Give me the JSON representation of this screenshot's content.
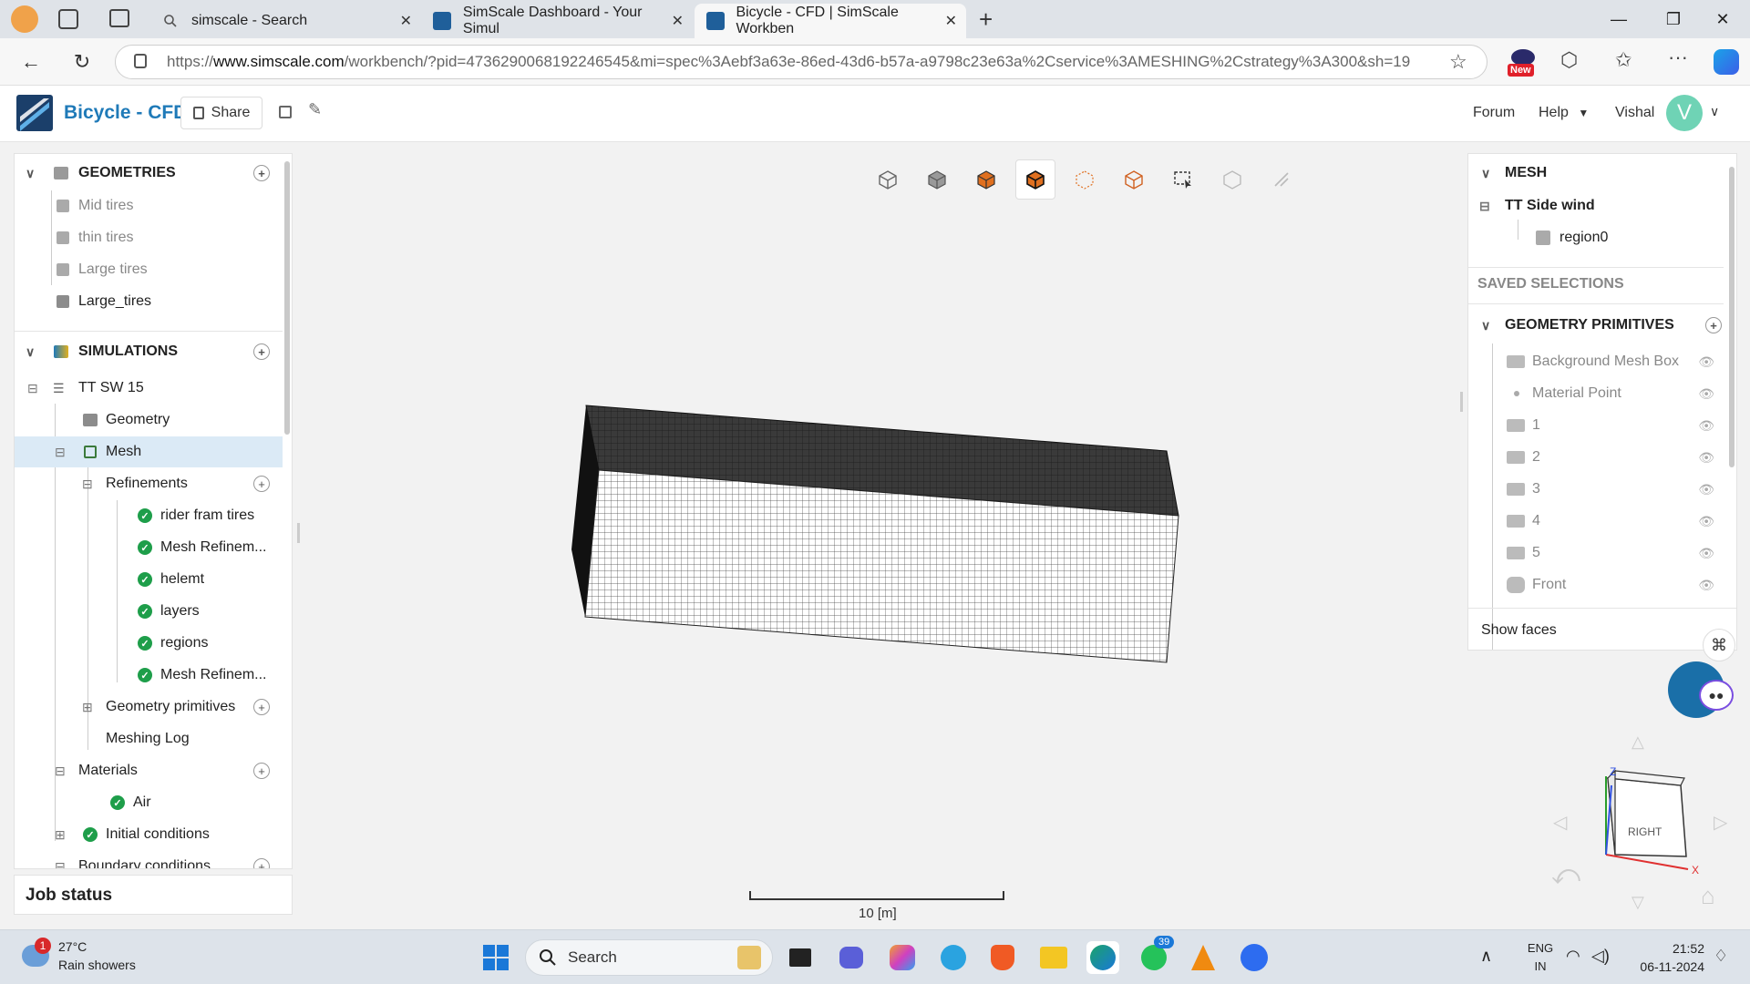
{
  "browser": {
    "tabs": [
      {
        "title": "simscale - Search",
        "active": false
      },
      {
        "title": "SimScale Dashboard - Your Simul",
        "active": false
      },
      {
        "title": "Bicycle - CFD | SimScale Workben",
        "active": true
      }
    ],
    "new_tab": "+",
    "url_prefix": "https://",
    "url_domain": "www.simscale.com",
    "url_rest": "/workbench/?pid=4736290068192246545&mi=spec%3Aebf3a63e-86ed-43d6-b57a-a9798c23e63a%2Cservice%3AMESHING%2Cstrategy%3A300&sh=19",
    "new_badge": "New"
  },
  "app": {
    "project_title": "Bicycle - CFD",
    "share_label": "Share",
    "forum_label": "Forum",
    "help_label": "Help",
    "user_name": "Vishal",
    "avatar_letter": "V",
    "brand_color": "#1f7ab8"
  },
  "tree": {
    "geometries_label": "GEOMETRIES",
    "geometries": [
      "Mid tires",
      "thin tires",
      "Large tires",
      "Large_tires"
    ],
    "simulations_label": "SIMULATIONS",
    "sim_name": "TT SW 15",
    "geometry_label": "Geometry",
    "mesh_label": "Mesh",
    "refinements_label": "Refinements",
    "refinements": [
      "rider fram tires",
      "Mesh Refinem...",
      "helemt",
      "layers",
      "regions",
      "Mesh Refinem..."
    ],
    "geometry_primitives_label": "Geometry primitives",
    "meshing_log_label": "Meshing Log",
    "materials_label": "Materials",
    "materials": [
      "Air"
    ],
    "initial_conditions_label": "Initial conditions",
    "boundary_conditions_label": "Boundary conditions"
  },
  "job_status_label": "Job status",
  "right_panel": {
    "mesh_label": "MESH",
    "selection_label": "TT Side wind",
    "region_label": "region0",
    "saved_selections_label": "SAVED SELECTIONS",
    "geometry_primitives_label": "GEOMETRY PRIMITIVES",
    "primitives": [
      "Background Mesh Box",
      "Material Point",
      "1",
      "2",
      "3",
      "4",
      "5",
      "Front"
    ],
    "show_faces_label": "Show faces"
  },
  "viewport": {
    "scale_label": "10 [m]",
    "view_cube_label": "RIGHT",
    "axis_z": "Z",
    "axis_x": "X"
  },
  "taskbar": {
    "temperature": "27°C",
    "weather": "Rain showers",
    "weather_badge": "1",
    "search_label": "Search",
    "whatsapp_badge": "39",
    "lang_top": "ENG",
    "lang_bottom": "IN",
    "time": "21:52",
    "date": "06-11-2024"
  }
}
